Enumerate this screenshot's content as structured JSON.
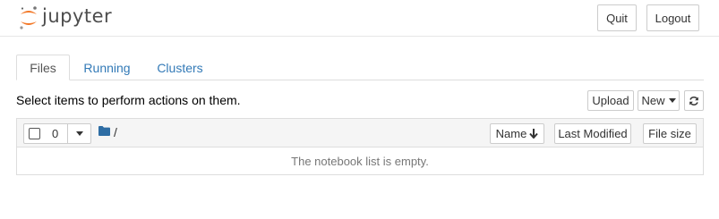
{
  "header": {
    "logo_text": "jupyter",
    "quit_label": "Quit",
    "logout_label": "Logout"
  },
  "tabs": [
    {
      "label": "Files",
      "active": true
    },
    {
      "label": "Running",
      "active": false
    },
    {
      "label": "Clusters",
      "active": false
    }
  ],
  "toolbar": {
    "hint": "Select items to perform actions on them.",
    "upload_label": "Upload",
    "new_label": "New",
    "refresh_icon": "refresh-icon"
  },
  "list": {
    "selected_count": "0",
    "breadcrumb_path": "/",
    "sort_name_label": "Name",
    "last_modified_label": "Last Modified",
    "file_size_label": "File size",
    "empty_message": "The notebook list is empty."
  },
  "colors": {
    "logo_orange": "#f37726",
    "link_blue": "#337ab7",
    "folder_blue": "#2e6da4"
  }
}
